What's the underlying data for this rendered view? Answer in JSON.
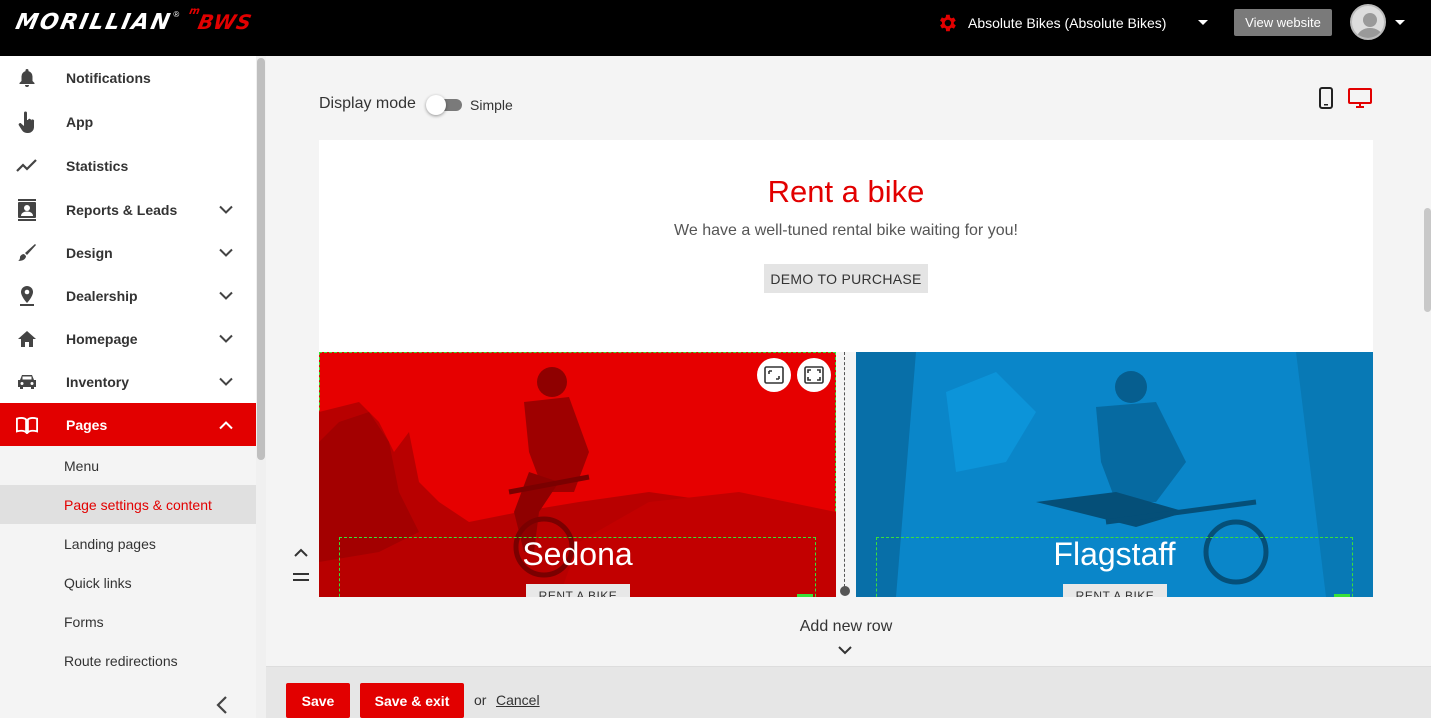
{
  "header": {
    "brand": "MORILLIAN",
    "brand_reg": "®",
    "product": "BWS",
    "product_prefix": "m",
    "dealer_name": "Absolute Bikes (Absolute Bikes)",
    "view_website": "View website"
  },
  "sidebar": {
    "items": [
      {
        "label": "Notifications",
        "icon": "bell-icon"
      },
      {
        "label": "App",
        "icon": "hand-pointer-icon"
      },
      {
        "label": "Statistics",
        "icon": "trend-line-icon"
      },
      {
        "label": "Reports & Leads",
        "icon": "contact-card-icon"
      },
      {
        "label": "Design",
        "icon": "brush-icon"
      },
      {
        "label": "Dealership",
        "icon": "map-pin-icon"
      },
      {
        "label": "Homepage",
        "icon": "home-icon"
      },
      {
        "label": "Inventory",
        "icon": "car-icon"
      },
      {
        "label": "Pages",
        "icon": "book-icon"
      }
    ],
    "pages_sub": [
      {
        "label": "Menu"
      },
      {
        "label": "Page settings & content"
      },
      {
        "label": "Landing pages"
      },
      {
        "label": "Quick links"
      },
      {
        "label": "Forms"
      },
      {
        "label": "Route redirections"
      }
    ]
  },
  "editor": {
    "display_mode_label": "Display mode",
    "mode_value": "Simple",
    "hero": {
      "title": "Rent a bike",
      "subtitle": "We have a well-tuned rental bike waiting for you!",
      "button": "DEMO TO PURCHASE"
    },
    "tiles": [
      {
        "title": "Sedona",
        "button": "RENT A BIKE",
        "color": "#e60000"
      },
      {
        "title": "Flagstaff",
        "button": "RENT A BIKE",
        "color": "#0a86c9"
      }
    ],
    "add_row": "Add new row"
  },
  "footer": {
    "save": "Save",
    "save_exit": "Save & exit",
    "or": "or",
    "cancel": "Cancel"
  },
  "colors": {
    "accent": "#e20000",
    "dashed_outline": "#39e039"
  }
}
